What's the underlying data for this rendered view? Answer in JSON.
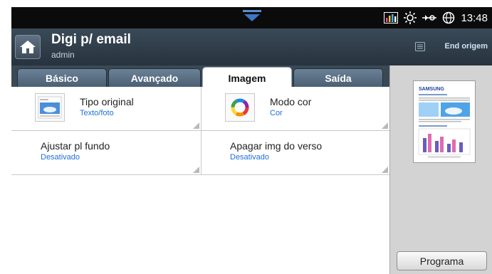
{
  "status_bar": {
    "time": "13:48",
    "icons": [
      "pull-down-tab-icon",
      "signal-bars-icon",
      "toner-sun-icon",
      "network-icon",
      "globe-icon"
    ]
  },
  "header": {
    "title": "Digi p/ email",
    "user": "admin",
    "end_origem": "End origem"
  },
  "tabs": [
    {
      "label": "Básico",
      "active": false
    },
    {
      "label": "Avançado",
      "active": false
    },
    {
      "label": "Imagem",
      "active": true
    },
    {
      "label": "Saída",
      "active": false
    }
  ],
  "options": {
    "tipo_original": {
      "label": "Tipo original",
      "value": "Texto/foto"
    },
    "modo_cor": {
      "label": "Modo cor",
      "value": "Cor"
    },
    "ajustar_fundo": {
      "label": "Ajustar pl fundo",
      "value": "Desativado"
    },
    "apagar_verso": {
      "label": "Apagar img do verso",
      "value": "Desativado"
    }
  },
  "preview": {
    "brand": "SAMSUNG",
    "button_label": "Programa"
  },
  "colors": {
    "accent_value": "#1d6fd8",
    "header_bg": "#2f3d49",
    "preview_bg": "#d3d3d3"
  }
}
